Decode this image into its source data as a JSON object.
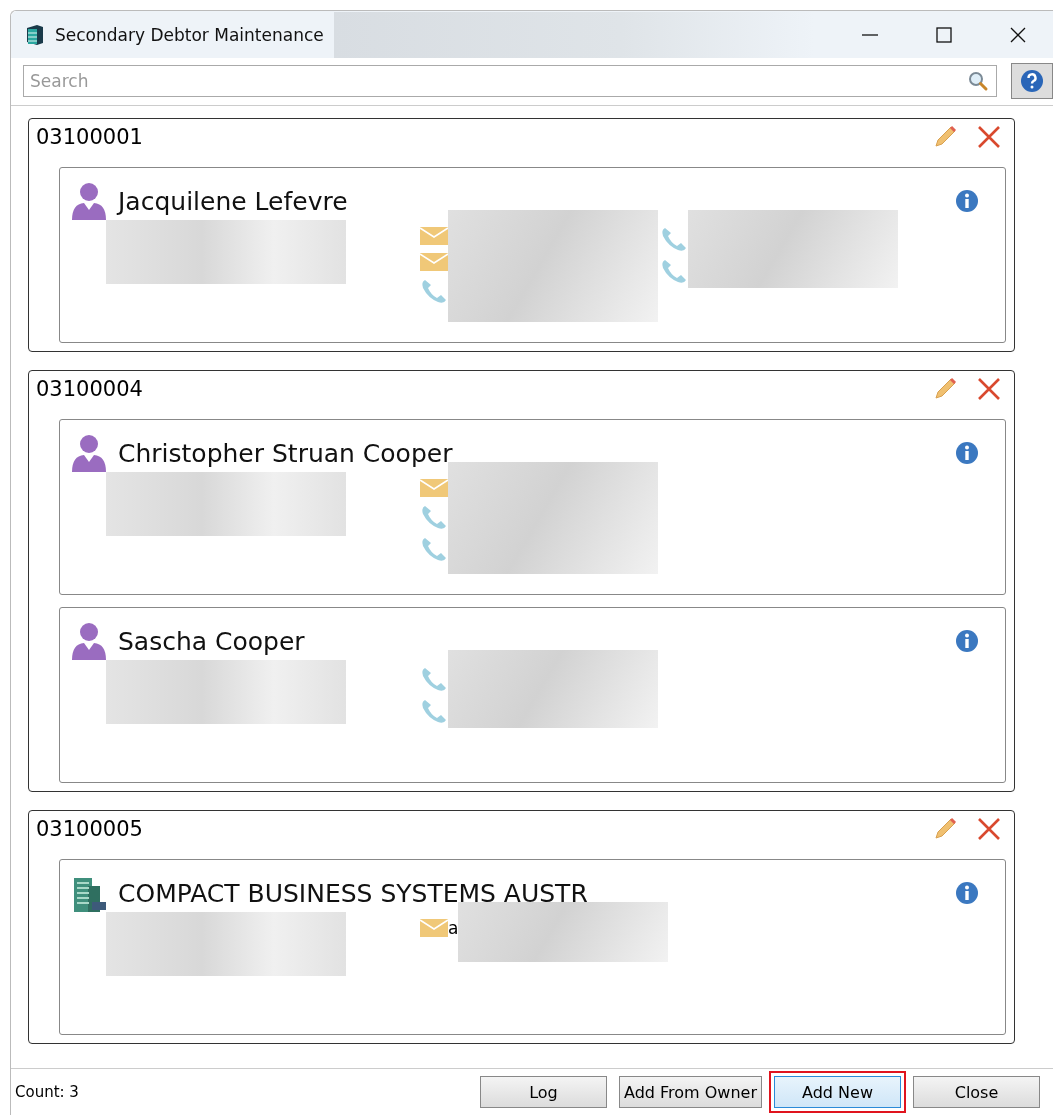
{
  "window": {
    "title": "Secondary Debtor Maintenance"
  },
  "search": {
    "placeholder": "Search"
  },
  "debtors": [
    {
      "code": "03100001",
      "contacts": [
        {
          "kind": "person",
          "name": "Jacquilene Lefevre",
          "columns": [
            {
              "icons": [
                {
                  "kind": "email"
                },
                {
                  "kind": "email"
                },
                {
                  "kind": "phone"
                }
              ]
            },
            {
              "icons": [
                {
                  "kind": "phone"
                },
                {
                  "kind": "phone"
                }
              ]
            }
          ]
        }
      ]
    },
    {
      "code": "03100004",
      "contacts": [
        {
          "kind": "person",
          "name": "Christopher Struan Cooper",
          "columns": [
            {
              "icons": [
                {
                  "kind": "email"
                },
                {
                  "kind": "phone"
                },
                {
                  "kind": "phone"
                }
              ]
            }
          ]
        },
        {
          "kind": "person",
          "name": "Sascha Cooper",
          "columns": [
            {
              "icons": [
                {
                  "kind": "phone"
                },
                {
                  "kind": "phone"
                }
              ]
            }
          ]
        }
      ]
    },
    {
      "code": "03100005",
      "contacts": [
        {
          "kind": "company",
          "name": "COMPACT BUSINESS SYSTEMS AUSTR",
          "columns": [
            {
              "icons": [
                {
                  "kind": "email"
                }
              ],
              "lead": "a"
            }
          ]
        }
      ]
    }
  ],
  "footer": {
    "count": "Count: 3",
    "buttons": [
      {
        "label": "Log",
        "selected": false,
        "highlighted": false
      },
      {
        "label": "Add From Owner",
        "selected": false,
        "highlighted": false
      },
      {
        "label": "Add New",
        "selected": true,
        "highlighted": true
      },
      {
        "label": "Close",
        "selected": false,
        "highlighted": false
      }
    ]
  }
}
